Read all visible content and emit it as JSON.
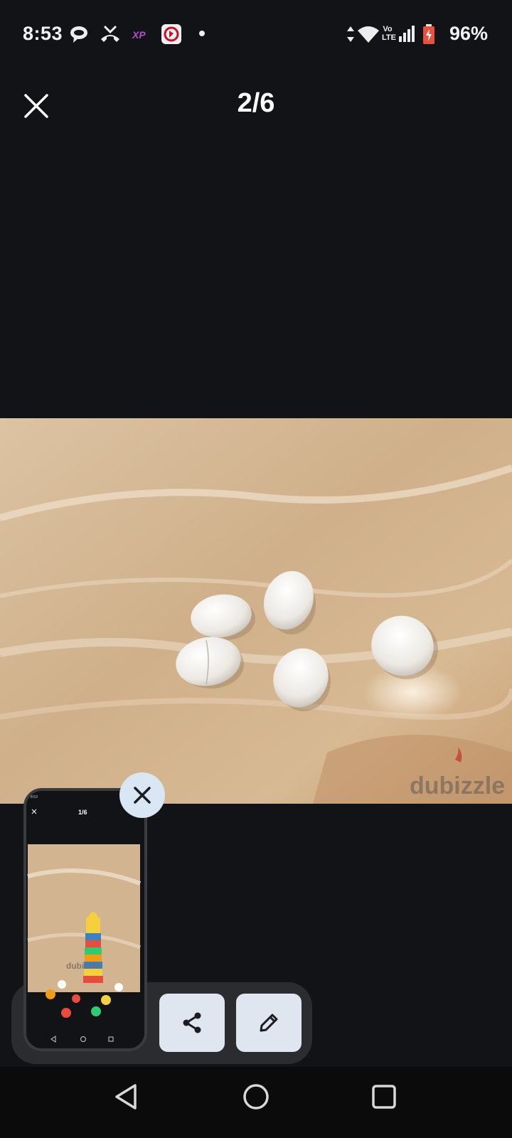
{
  "status_bar": {
    "time": "8:53",
    "battery": "96%",
    "network_lte": "LTE",
    "network_vo": "Vo"
  },
  "viewer": {
    "counter": "2/6",
    "close_icon": "close-icon"
  },
  "main_image": {
    "watermark": "dubizzle",
    "description_icon": "photo of white plastic eggs on marble"
  },
  "thumbnail": {
    "counter": "1/6",
    "watermark": "dubizzle",
    "dismiss_icon": "close-icon"
  },
  "actions": {
    "share_icon": "share-icon",
    "edit_icon": "pencil-icon"
  },
  "nav": {
    "back_icon": "back-triangle-icon",
    "home_icon": "home-circle-icon",
    "recents_icon": "recents-square-icon"
  },
  "colors": {
    "background": "#121316",
    "panel": "#2b2c30",
    "button": "#e0e6f0",
    "dismiss": "#d9e6f4"
  }
}
